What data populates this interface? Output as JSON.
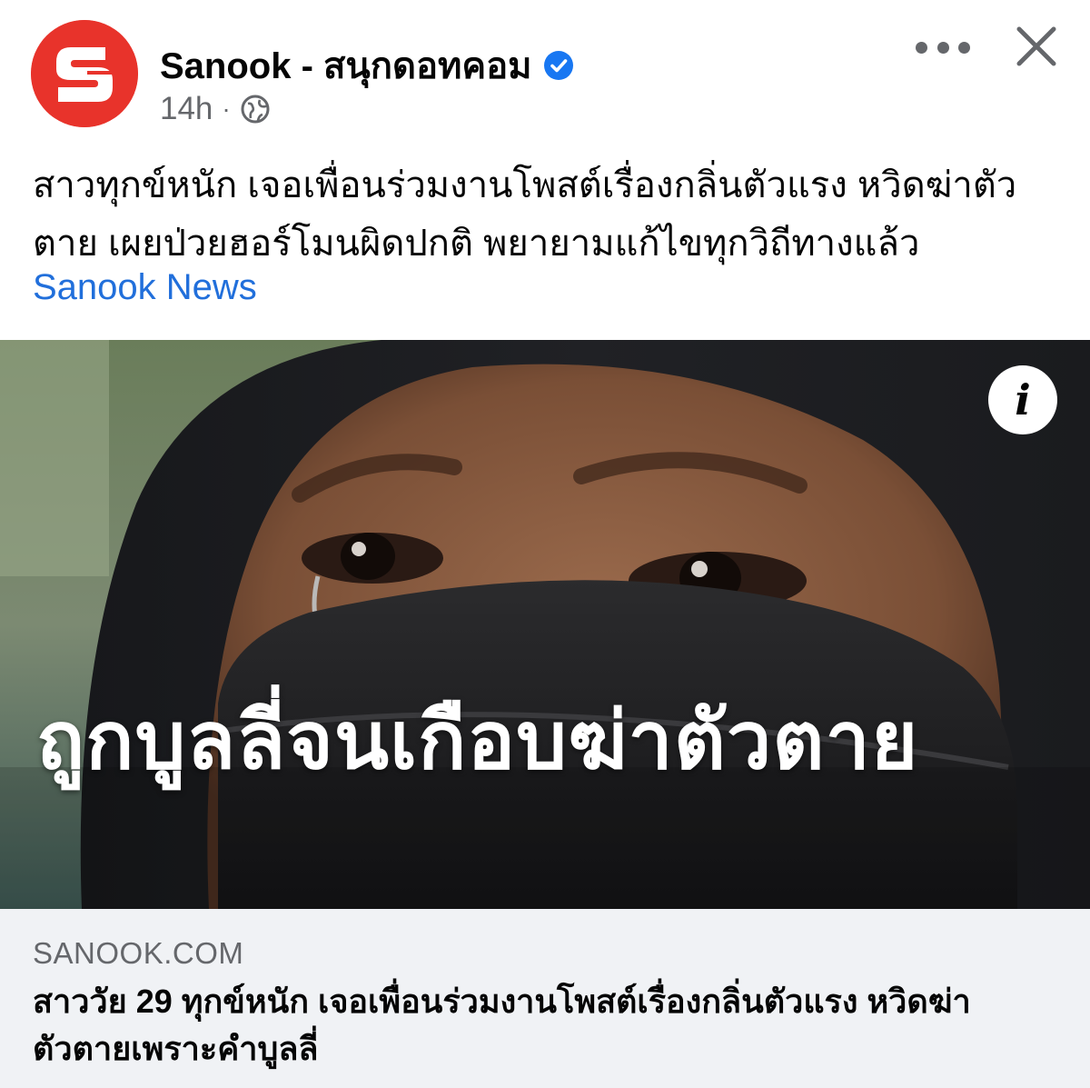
{
  "header": {
    "page_name": "Sanook - สนุกดอทคอม",
    "time": "14h",
    "separator": "·",
    "avatar_letter": "S",
    "verified_icon": "verified-badge-icon",
    "privacy_icon": "globe-icon",
    "more_icon": "more-options-icon",
    "close_icon": "close-icon"
  },
  "post": {
    "caption_lines": [
      "สาวทุกข์หนัก เจอเพื่อนร่วมงานโพสต์เรื่องกลิ่นตัวแรง หวิดฆ่าตัว",
      "ตาย เผยป่วยฮอร์โมนผิดปกติ พยายามแก้ไขทุกวิถีทางแล้ว"
    ],
    "link_text": "Sanook News"
  },
  "image": {
    "overlay_text": "ถูกบูลลี่จนเกือบฆ่าตัวตาย",
    "info_icon": "info-icon",
    "info_label": "i"
  },
  "preview": {
    "domain": "SANOOK.COM",
    "title_lines": [
      "สาววัย 29 ทุกข์หนัก เจอเพื่อนร่วมงานโพสต์เรื่องกลิ่นตัวแรง หวิดฆ่า",
      "ตัวตายเพราะคำบูลลี่"
    ]
  },
  "colors": {
    "brand_red": "#e8332b",
    "verified_blue": "#1877f2",
    "link_blue": "#216fdb",
    "secondary_text": "#65676b",
    "preview_bg": "#f0f2f5"
  }
}
